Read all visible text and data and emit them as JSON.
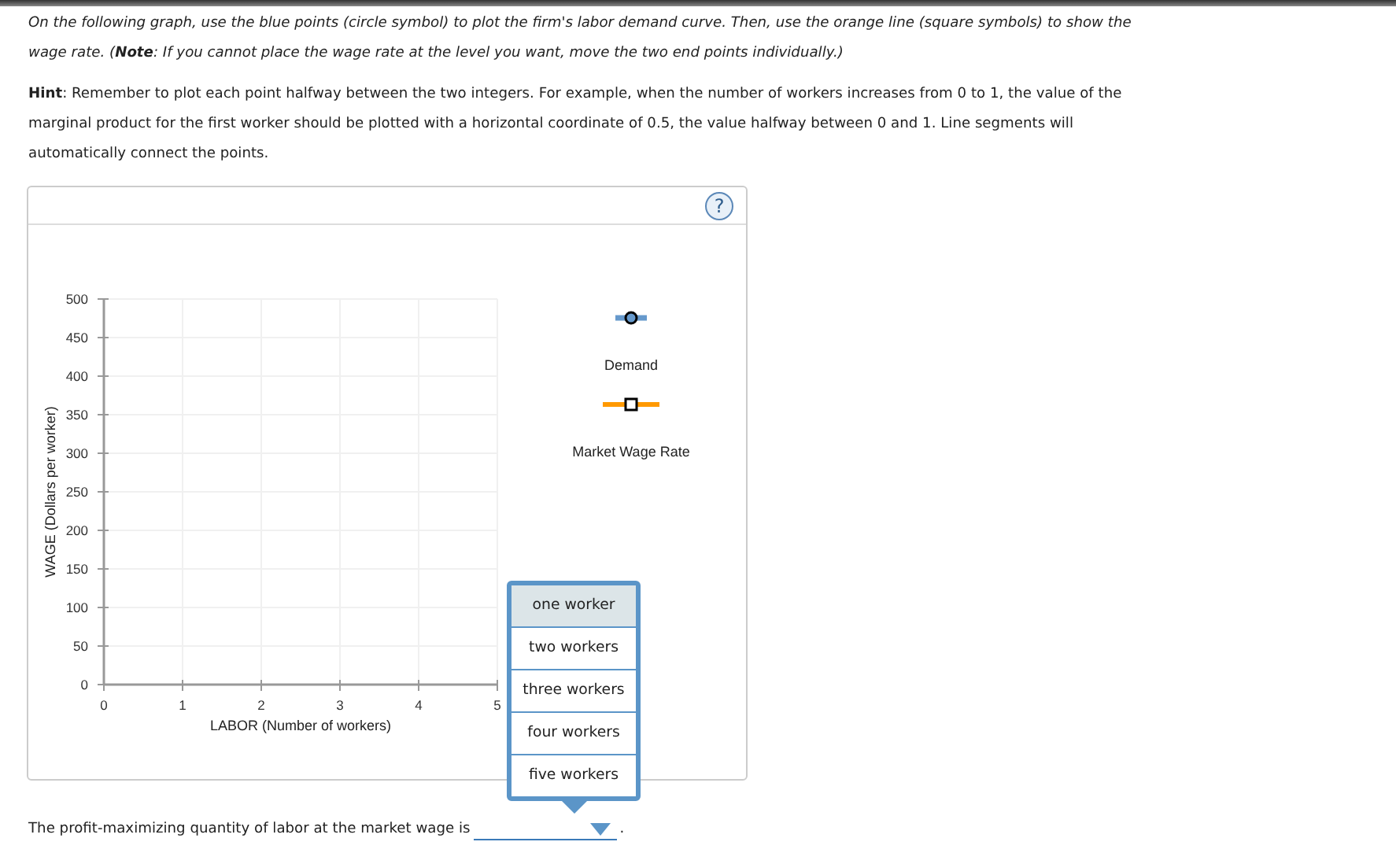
{
  "instructions": "On the following graph, use the blue points (circle symbol) to plot the firm's labor demand curve. Then, use the orange line (square symbols) to show the wage rate. (**Note**: If you cannot place the wage rate at the level you want, move the two end points individually.)",
  "hint": "**Hint**: Remember to plot each point halfway between the two integers. For example, when the number of workers increases from 0 to 1, the value of the marginal product for the first worker should be plotted with a horizontal coordinate of 0.5, the value halfway between 0 and 1. Line segments will automatically connect the points.",
  "help_button": "?",
  "chart_data": {
    "type": "line",
    "grid": true,
    "xlabel": "LABOR (Number of workers)",
    "ylabel": "WAGE (Dollars per worker)",
    "xlim": [
      0,
      5
    ],
    "ylim": [
      0,
      500
    ],
    "xticks": [
      0,
      1,
      2,
      3,
      4,
      5
    ],
    "yticks": [
      0,
      50,
      100,
      150,
      200,
      250,
      300,
      350,
      400,
      450,
      500
    ]
  },
  "legend": [
    {
      "kind": "circle",
      "label": "Demand",
      "color": "#6699cc"
    },
    {
      "kind": "square",
      "label": "Market Wage Rate",
      "color": "#ff9900"
    }
  ],
  "question": {
    "text": "The profit-maximizing quantity of labor at the market wage is",
    "end": ".",
    "dropdown": {
      "expanded": true,
      "options": [
        {
          "label": "one worker",
          "selected": true
        },
        {
          "label": "two workers",
          "selected": false
        },
        {
          "label": "three workers",
          "selected": false
        },
        {
          "label": "four workers",
          "selected": false
        },
        {
          "label": "five workers",
          "selected": false
        }
      ]
    }
  }
}
